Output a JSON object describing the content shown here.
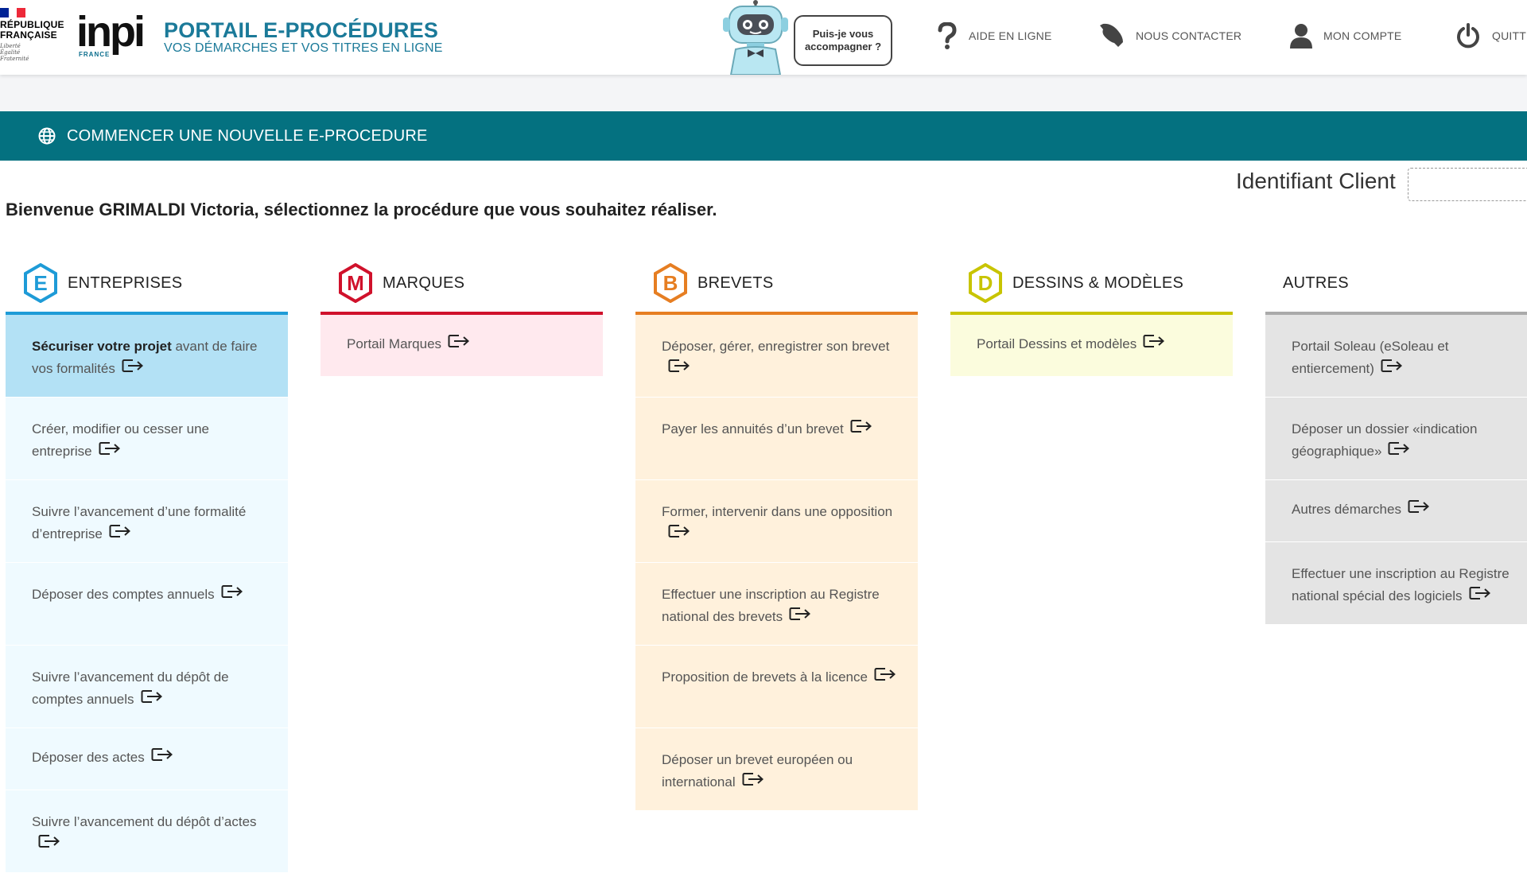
{
  "header": {
    "republique_line1": "RÉPUBLIQUE",
    "republique_line2": "FRANÇAISE",
    "motto": [
      "Liberté",
      "Égalité",
      "Fraternité"
    ],
    "inpi_logo": "inpi",
    "inpi_sub": "FRANCE",
    "portal_title": "PORTAIL E-PROCÉDURES",
    "portal_subtitle": "VOS DÉMARCHES ET VOS TITRES EN LIGNE",
    "bubble_line1": "Puis-je vous",
    "bubble_line2": "accompagner ?",
    "nav": {
      "help": "AIDE EN LIGNE",
      "contact": "NOUS CONTACTER",
      "account": "MON COMPTE",
      "quit": "QUITTER"
    }
  },
  "banner": {
    "label": "COMMENCER UNE NOUVELLE E-PROCEDURE"
  },
  "identifiant": {
    "label": "Identifiant Client",
    "value": ""
  },
  "welcome": "Bienvenue GRIMALDI Victoria, sélectionnez la procédure que vous souhaitez réaliser.",
  "colors": {
    "teal": "#047180",
    "entreprises": "#1e9bd7",
    "marques": "#d0112b",
    "brevets": "#e67e22",
    "dessins": "#c8c400",
    "autres": "#aaaaaa"
  },
  "columns": [
    {
      "key": "entreprises",
      "letter": "E",
      "title": "ENTREPRISES",
      "items": [
        {
          "bold": "Sécuriser votre projet",
          "text": " avant de faire vos formalités"
        },
        {
          "bold": "",
          "text": "Créer, modifier ou cesser une entreprise"
        },
        {
          "bold": "",
          "text": "Suivre l’avancement d’une formalité d’entreprise"
        },
        {
          "bold": "",
          "text": "Déposer des comptes annuels"
        },
        {
          "bold": "",
          "text": "Suivre l’avancement du dépôt de comptes annuels"
        },
        {
          "bold": "",
          "text": "Déposer des actes"
        },
        {
          "bold": "",
          "text": "Suivre l’avancement du dépôt d’actes"
        }
      ]
    },
    {
      "key": "marques",
      "letter": "M",
      "title": "MARQUES",
      "items": [
        {
          "bold": "",
          "text": "Portail Marques"
        }
      ]
    },
    {
      "key": "brevets",
      "letter": "B",
      "title": "BREVETS",
      "items": [
        {
          "bold": "",
          "text": "Déposer, gérer, enregistrer son brevet"
        },
        {
          "bold": "",
          "text": "Payer les annuités d’un brevet"
        },
        {
          "bold": "",
          "text": "Former, intervenir dans une opposition"
        },
        {
          "bold": "",
          "text": "Effectuer une inscription au Registre national des brevets"
        },
        {
          "bold": "",
          "text": "Proposition de brevets à la licence"
        },
        {
          "bold": "",
          "text": "Déposer un brevet européen ou international"
        }
      ]
    },
    {
      "key": "dessins",
      "letter": "D",
      "title": "DESSINS & MODÈLES",
      "items": [
        {
          "bold": "",
          "text": "Portail Dessins et modèles"
        }
      ]
    },
    {
      "key": "autres",
      "letter": "",
      "title": "AUTRES",
      "items": [
        {
          "bold": "",
          "text": "Portail Soleau (eSoleau et entiercement)"
        },
        {
          "bold": "",
          "text": "Déposer un dossier «indication géographique»"
        },
        {
          "bold": "",
          "text": "Autres démarches"
        },
        {
          "bold": "",
          "text": "Effectuer une inscription au Registre national spécial des logiciels"
        }
      ]
    }
  ]
}
